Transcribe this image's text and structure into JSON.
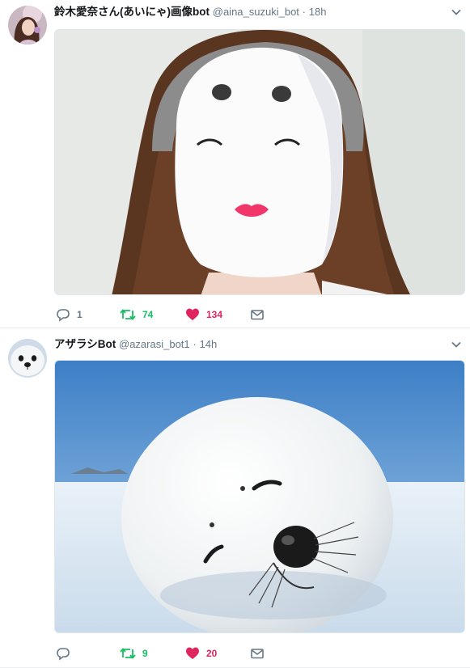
{
  "tweets": [
    {
      "display_name": "鈴木愛奈さん(あいにゃ)画像bot",
      "handle": "@aina_suzuki_bot",
      "separator": "·",
      "time": "18h",
      "avatar_icon": "portrait-avatar",
      "media_description": "",
      "actions": {
        "reply_count": "1",
        "retweet_count": "74",
        "like_count": "134"
      },
      "colors": {
        "retweet": "#17bf63",
        "like": "#e0245e",
        "muted": "#657786"
      }
    },
    {
      "display_name": "アザラシBot",
      "handle": "@azarasi_bot1",
      "separator": "·",
      "time": "14h",
      "avatar_icon": "seal-avatar",
      "media_description": "",
      "actions": {
        "reply_count": "",
        "retweet_count": "9",
        "like_count": "20"
      },
      "colors": {
        "retweet": "#17bf63",
        "like": "#e0245e",
        "muted": "#657786"
      }
    }
  ]
}
